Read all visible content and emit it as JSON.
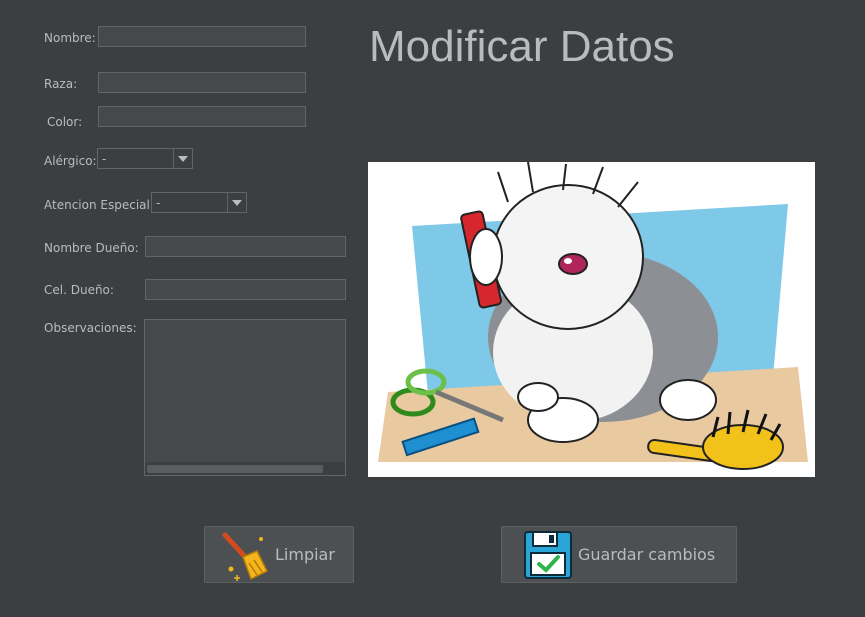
{
  "window": {
    "title": "Modificar Datos"
  },
  "form": {
    "nombre_label": "Nombre:",
    "nombre_value": "",
    "raza_label": "Raza:",
    "raza_value": "",
    "color_label": "Color:",
    "color_value": "",
    "alergico_label": "Alérgico:",
    "alergico_value": "-",
    "atencion_label": "Atencion Especial:",
    "atencion_value": "-",
    "nombre_dueno_label": "Nombre Dueño:",
    "nombre_dueno_value": "",
    "cel_dueno_label": "Cel. Dueño:",
    "cel_dueno_value": "",
    "observaciones_label": "Observaciones:",
    "observaciones_value": ""
  },
  "buttons": {
    "limpiar_label": "Limpiar",
    "guardar_label": "Guardar cambios"
  },
  "image": {
    "subject": "old-english-sheepdog-grooming-illustration"
  },
  "icons": {
    "limpiar": "broom-icon",
    "guardar": "floppy-disk-check-icon"
  },
  "colors": {
    "background": "#3c3f41",
    "field": "#45494a",
    "text": "#bbbbbb",
    "button": "#4c5052"
  }
}
